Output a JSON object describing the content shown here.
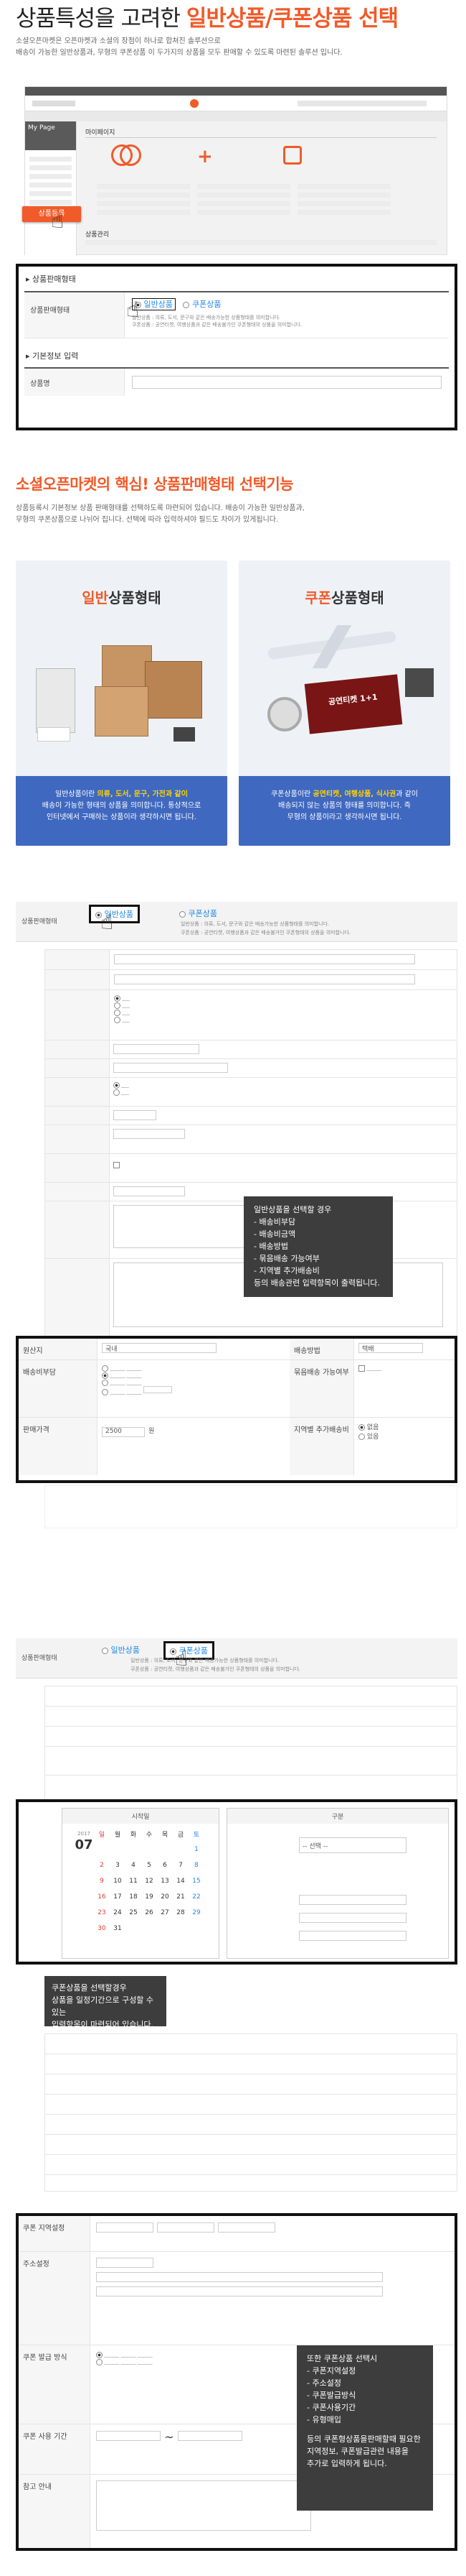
{
  "header": {
    "title_prefix": "상품특성을 고려한 ",
    "title_highlight": "일반상품/쿠폰상품 선택",
    "intro_line1": "소셜오픈마켓은 오픈마켓과 소셜의 장점이 하나로 합쳐진 솔루션으로",
    "intro_line2": "배송이 가능한 일반상품과, 무형의 쿠폰상품 이 두가지의 상품을 모두 판매할 수 있도록 마련된 솔루션 입니다."
  },
  "mypage": {
    "panel_title": "My Page",
    "section_title": "마이페이지",
    "product_register_button": "상품등록",
    "product_management_label": "상품관리"
  },
  "product_type_form": {
    "section_label": "상품판매형태",
    "row_label": "상품판매형태",
    "option_general": "일반상품",
    "option_coupon": "쿠폰상품",
    "desc_general": "일반상품 : 의류, 도서, 문구와 같은 배송가능한 상품형태를 의미합니다.",
    "desc_coupon": "쿠폰상품 : 공연티켓, 여행상품과 같은 배송불가인 쿠폰형태의 상품을 의미합니다.",
    "basic_info_label": "기본정보 입력",
    "product_name_label": "상품명"
  },
  "section2": {
    "heading": "소셜오픈마켓의 핵심! 상품판매형태 선택기능",
    "line1": "상품등록시 기본정보 상품 판매형태를 선택하도록 마련되어 있습니다. 배송이 가능한 일반상품과,",
    "line2": "무형의 쿠폰상품으로 나뉘어 집니다. 선택에 따라 입력하셔야 필드도 차이가 있게됩니다."
  },
  "card_general": {
    "title_colored": "일반",
    "title_rest": "상품형태",
    "desc_pre": "일반상품이란 ",
    "desc_highlight": "의류, 도서, 문구, 가전과 같이",
    "desc_line2": "배송이 가능한 형태의 상품을 의미합니다. 통상적으로",
    "desc_line3": "인터넷에서 구매하는 상품이라 생각하시면 됩니다."
  },
  "card_coupon": {
    "title_colored": "쿠폰",
    "title_rest": "상품형태",
    "desc_pre": "쿠폰상품이란 ",
    "desc_highlight": "공연티켓, 여행상품, 식사권",
    "desc_mid": "과 같이",
    "desc_line2": "배송되지 않는 상품의 형태를 의미합니다. 즉",
    "desc_line3": "무형의 상품이라고 생각하시면 됩니다.",
    "ticket_text": "공연티켓 1+1"
  },
  "general_form": {
    "row_label": "상품판매형태",
    "option_general": "일반상품",
    "option_coupon": "쿠폰상품",
    "desc_general": "일반상품 : 의류, 도서, 문구와 같은 배송가능한 상품형태를 의미합니다.",
    "desc_coupon": "쿠폰상품 : 공연티켓, 여행상품과 같은 배송불가인 쿠폰형태의 상품을 의미합니다.",
    "popup_title": "일반상품을 선택할 경우",
    "popup_items": [
      "- 배송비부담",
      "- 배송비금액",
      "- 배송방법",
      "- 묶음배송 가능여부",
      "- 지역별 추가배송비"
    ],
    "popup_footer": "등의 배송관련 입력항목이 출력됩니다.",
    "shipping_label": "배송비부담",
    "shipping_method_label": "배송방법",
    "shipping_method_value": "택배",
    "bundle_label": "묶음배송 가능여부",
    "origin_label": "원산지",
    "origin_value": "국내",
    "shipping_cost_value": "2500",
    "shipping_cost_unit": "원",
    "region_label": "지역별 추가배송비",
    "region_opt1": "없음",
    "region_opt2": "있음",
    "price_label": "판매가격"
  },
  "coupon_form": {
    "row_label": "상품판매형태",
    "option_general": "일반상품",
    "option_coupon": "쿠폰상품",
    "desc_general": "일반상품 : 의류, 도서, 문구와 같은 배송가능한 상품형태를 의미합니다.",
    "desc_coupon": "쿠폰상품 : 공연티켓, 여행상품과 같은 배송불가인 쿠폰형태의 상품을 의미합니다.",
    "calendar_title": "시작일",
    "calendar_year": "2017",
    "calendar_month": "07",
    "calendar_weekdays": [
      "일",
      "월",
      "화",
      "수",
      "목",
      "금",
      "토"
    ],
    "calendar_days": [
      "",
      "",
      "",
      "",
      "",
      "",
      "1",
      "2",
      "3",
      "4",
      "5",
      "6",
      "7",
      "8",
      "9",
      "10",
      "11",
      "12",
      "13",
      "14",
      "15",
      "16",
      "17",
      "18",
      "19",
      "20",
      "21",
      "22",
      "23",
      "24",
      "25",
      "26",
      "27",
      "28",
      "29",
      "30",
      "31",
      "",
      "",
      "",
      "",
      ""
    ],
    "right_panel_title": "구분",
    "select_placeholder": "-- 선택 --",
    "popup1_line1": "쿠폰상품을 선택할경우",
    "popup1_line2": "상품을 일정기간으로 구성할 수 있는",
    "popup1_line3": "입력항목이 마련되어 있습니다.",
    "popup2_title": "또한 쿠폰상품 선택시",
    "popup2_items": [
      "- 쿠폰지역설정",
      "- 주소설정",
      "- 쿠폰발급방식",
      "- 쿠폰사용기간",
      "- 유형매입"
    ],
    "popup2_footer1": "등의 쿠폰형상품을판매할때 필요한",
    "popup2_footer2": "지역정보, 쿠폰발급관련 내용을",
    "popup2_footer3": "추가로 입력하게 됩니다.",
    "coupon_region_label": "쿠폰 지역설정",
    "address_label": "주소설정",
    "issue_method_label": "쿠폰 발급 방식",
    "usage_period_label": "쿠폰 사용 기간",
    "note_label": "참고 안내"
  },
  "colors": {
    "accent": "#f15a29",
    "blue_bar": "#3f68c0",
    "dark_popup": "#3d3d3d"
  }
}
